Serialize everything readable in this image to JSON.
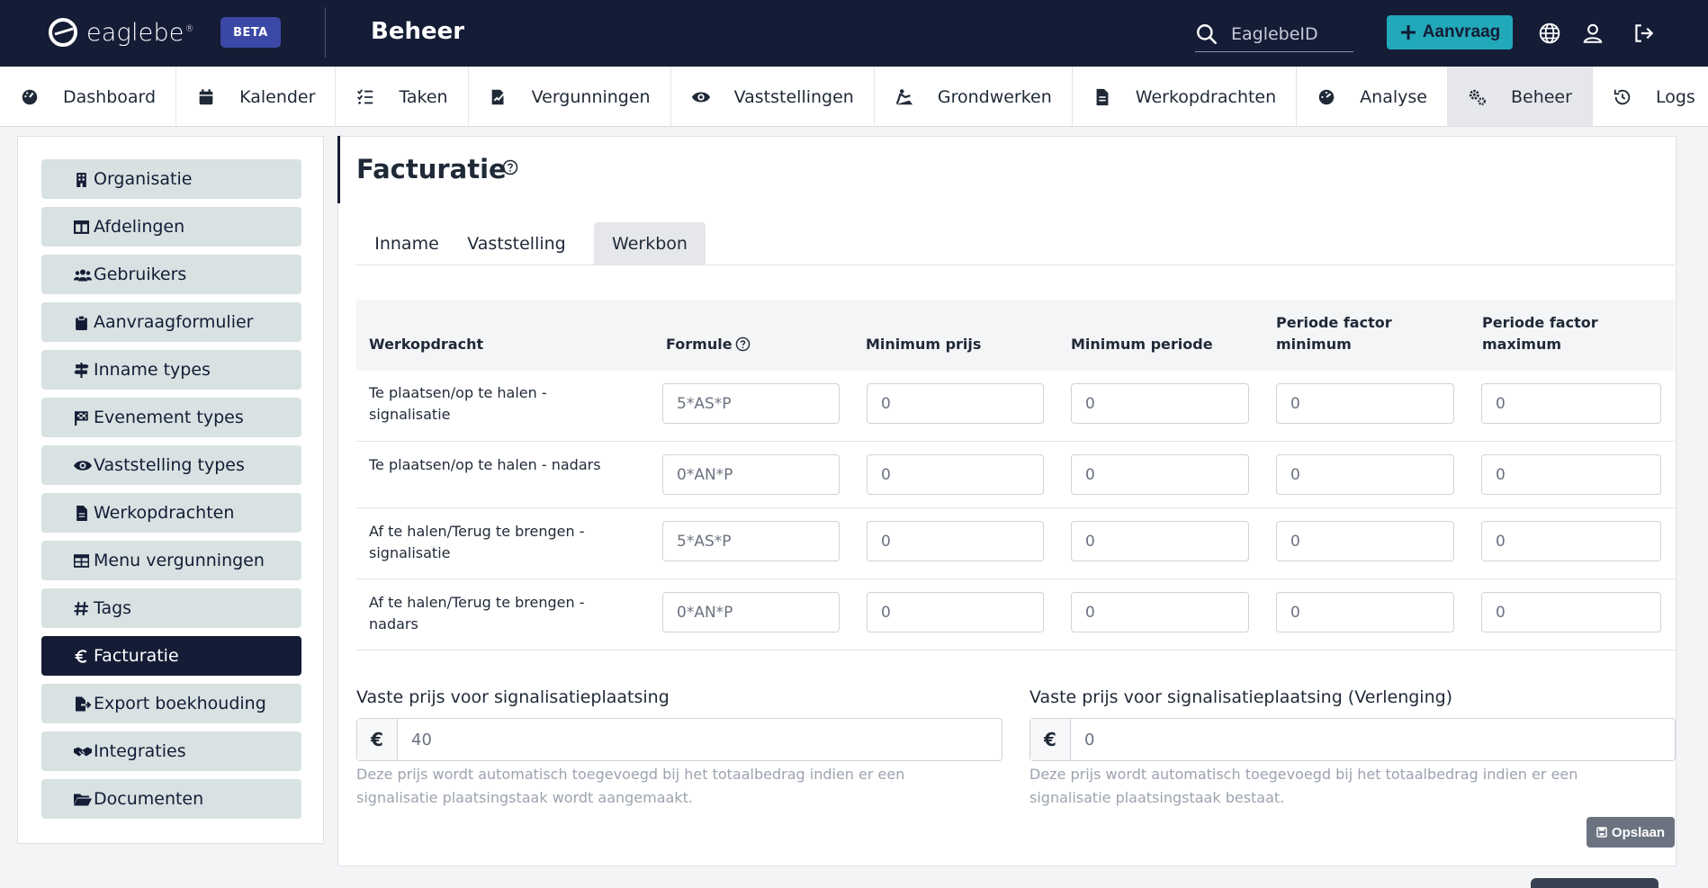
{
  "header": {
    "logo_text": "eaglebe",
    "logo_mark": "®",
    "beta": "BETA",
    "title": "Beheer",
    "search_placeholder": "EaglebeID",
    "aanvraag_label": "Aanvraag",
    "icons": [
      "globe-icon",
      "user-icon",
      "logout-icon"
    ]
  },
  "nav": {
    "items": [
      {
        "label": "Dashboard",
        "icon": "dashboard-icon"
      },
      {
        "label": "Kalender",
        "icon": "calendar-icon"
      },
      {
        "label": "Taken",
        "icon": "tasks-icon"
      },
      {
        "label": "Vergunningen",
        "icon": "permit-icon"
      },
      {
        "label": "Vaststellingen",
        "icon": "eye-icon"
      },
      {
        "label": "Grondwerken",
        "icon": "digging-icon"
      },
      {
        "label": "Werkopdrachten",
        "icon": "file-icon"
      },
      {
        "label": "Analyse",
        "icon": "gauge-icon"
      },
      {
        "label": "Beheer",
        "icon": "gears-icon",
        "active": true
      },
      {
        "label": "Logs",
        "icon": "history-icon"
      }
    ]
  },
  "sidebar": {
    "items": [
      {
        "label": "Organisatie",
        "icon": "building-icon"
      },
      {
        "label": "Afdelingen",
        "icon": "table-columns-icon"
      },
      {
        "label": "Gebruikers",
        "icon": "users-icon"
      },
      {
        "label": "Aanvraagformulier",
        "icon": "clipboard-icon"
      },
      {
        "label": "Inname types",
        "icon": "signs-icon"
      },
      {
        "label": "Evenement types",
        "icon": "flag-icon"
      },
      {
        "label": "Vaststelling types",
        "icon": "eye-icon"
      },
      {
        "label": "Werkopdrachten",
        "icon": "file-icon"
      },
      {
        "label": "Menu vergunningen",
        "icon": "table-icon"
      },
      {
        "label": "Tags",
        "icon": "hashtag-icon"
      },
      {
        "label": "Facturatie",
        "icon": "euro-icon",
        "active": true
      },
      {
        "label": "Export boekhouding",
        "icon": "file-export-icon"
      },
      {
        "label": "Integraties",
        "icon": "handshake-icon"
      },
      {
        "label": "Documenten",
        "icon": "folder-icon"
      }
    ]
  },
  "main": {
    "title": "Facturatie",
    "tabs": [
      {
        "label": "Inname"
      },
      {
        "label": "Vaststelling"
      },
      {
        "label": "Werkbon",
        "active": true
      }
    ],
    "table": {
      "headers": {
        "werkopdracht": "Werkopdracht",
        "formule": "Formule",
        "min_prijs": "Minimum prijs",
        "min_periode": "Minimum periode",
        "pf_min_1": "Periode factor",
        "pf_min_2": "minimum",
        "pf_max_1": "Periode factor",
        "pf_max_2": "maximum"
      },
      "rows": [
        {
          "label_1": "Te plaatsen/op te halen -",
          "label_2": "signalisatie",
          "formule": "5*AS*P",
          "min_prijs": "0",
          "min_periode": "0",
          "pf_min": "0",
          "pf_max": "0"
        },
        {
          "label_1": "Te plaatsen/op te halen - nadars",
          "label_2": "",
          "formule": "0*AN*P",
          "min_prijs": "0",
          "min_periode": "0",
          "pf_min": "0",
          "pf_max": "0"
        },
        {
          "label_1": "Af te halen/Terug te brengen -",
          "label_2": "signalisatie",
          "formule": "5*AS*P",
          "min_prijs": "0",
          "min_periode": "0",
          "pf_min": "0",
          "pf_max": "0"
        },
        {
          "label_1": "Af te halen/Terug te brengen -",
          "label_2": "nadars",
          "formule": "0*AN*P",
          "min_prijs": "0",
          "min_periode": "0",
          "pf_min": "0",
          "pf_max": "0"
        }
      ]
    },
    "fixed_price": {
      "label": "Vaste prijs voor signalisatieplaatsing",
      "currency": "€",
      "value": "40",
      "help_1": "Deze prijs wordt automatisch toegevoegd bij het totaalbedrag indien er een",
      "help_2": "signalisatie plaatsingstaak wordt aangemaakt."
    },
    "fixed_price_ext": {
      "label": "Vaste prijs voor signalisatieplaatsing (Verlenging)",
      "currency": "€",
      "value": "0",
      "help_1": "Deze prijs wordt automatisch toegevoegd bij het totaalbedrag indien er een",
      "help_2": "signalisatie plaatsingstaak bestaat."
    },
    "save_label": "Opslaan"
  }
}
